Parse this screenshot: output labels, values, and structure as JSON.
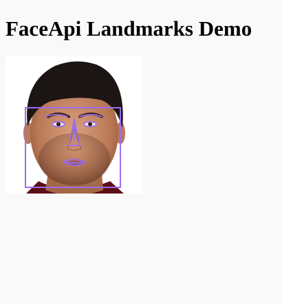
{
  "page": {
    "title": "FaceApi Landmarks Demo"
  },
  "detection": {
    "face_image": "portrait-photo",
    "overlay_color": "#9b6cf0",
    "overlays": [
      "face-box",
      "landmarks"
    ]
  }
}
